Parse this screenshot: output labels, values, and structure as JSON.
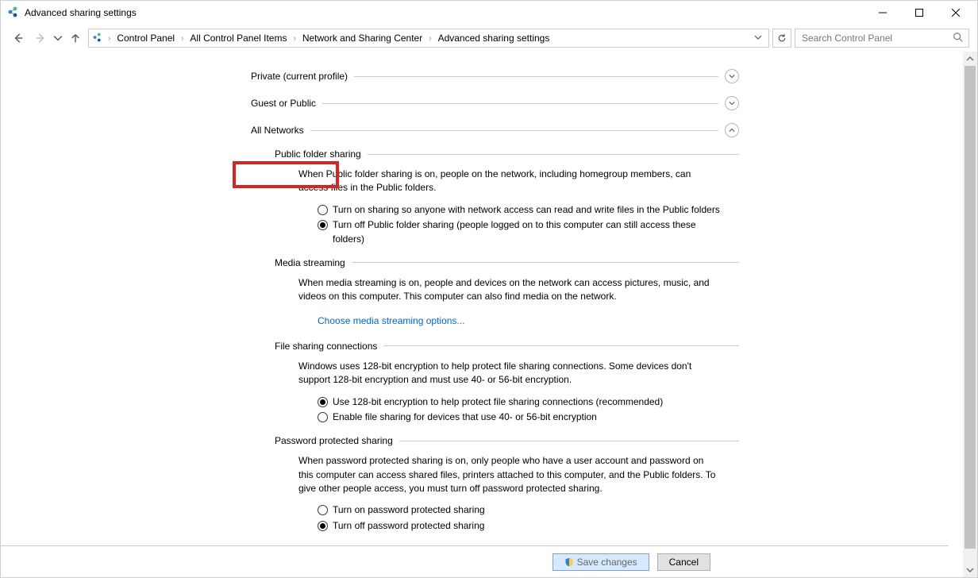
{
  "window": {
    "title": "Advanced sharing settings"
  },
  "breadcrumbs": {
    "b0": "Control Panel",
    "b1": "All Control Panel Items",
    "b2": "Network and Sharing Center",
    "b3": "Advanced sharing settings"
  },
  "search": {
    "placeholder": "Search Control Panel"
  },
  "profiles": {
    "private": "Private (current profile)",
    "guest": "Guest or Public",
    "all": "All Networks"
  },
  "pfs": {
    "heading": "Public folder sharing",
    "desc": "When Public folder sharing is on, people on the network, including homegroup members, can access files in the Public folders.",
    "opt1": "Turn on sharing so anyone with network access can read and write files in the Public folders",
    "opt2": "Turn off Public folder sharing (people logged on to this computer can still access these folders)"
  },
  "media": {
    "heading": "Media streaming",
    "desc": "When media streaming is on, people and devices on the network can access pictures, music, and videos on this computer. This computer can also find media on the network.",
    "link": "Choose media streaming options..."
  },
  "fsc": {
    "heading": "File sharing connections",
    "desc": "Windows uses 128-bit encryption to help protect file sharing connections. Some devices don't support 128-bit encryption and must use 40- or 56-bit encryption.",
    "opt1": "Use 128-bit encryption to help protect file sharing connections (recommended)",
    "opt2": "Enable file sharing for devices that use 40- or 56-bit encryption"
  },
  "pps": {
    "heading": "Password protected sharing",
    "desc": "When password protected sharing is on, only people who have a user account and password on this computer can access shared files, printers attached to this computer, and the Public folders. To give other people access, you must turn off password protected sharing.",
    "opt1": "Turn on password protected sharing",
    "opt2": "Turn off password protected sharing"
  },
  "buttons": {
    "save": "Save changes",
    "cancel": "Cancel"
  }
}
